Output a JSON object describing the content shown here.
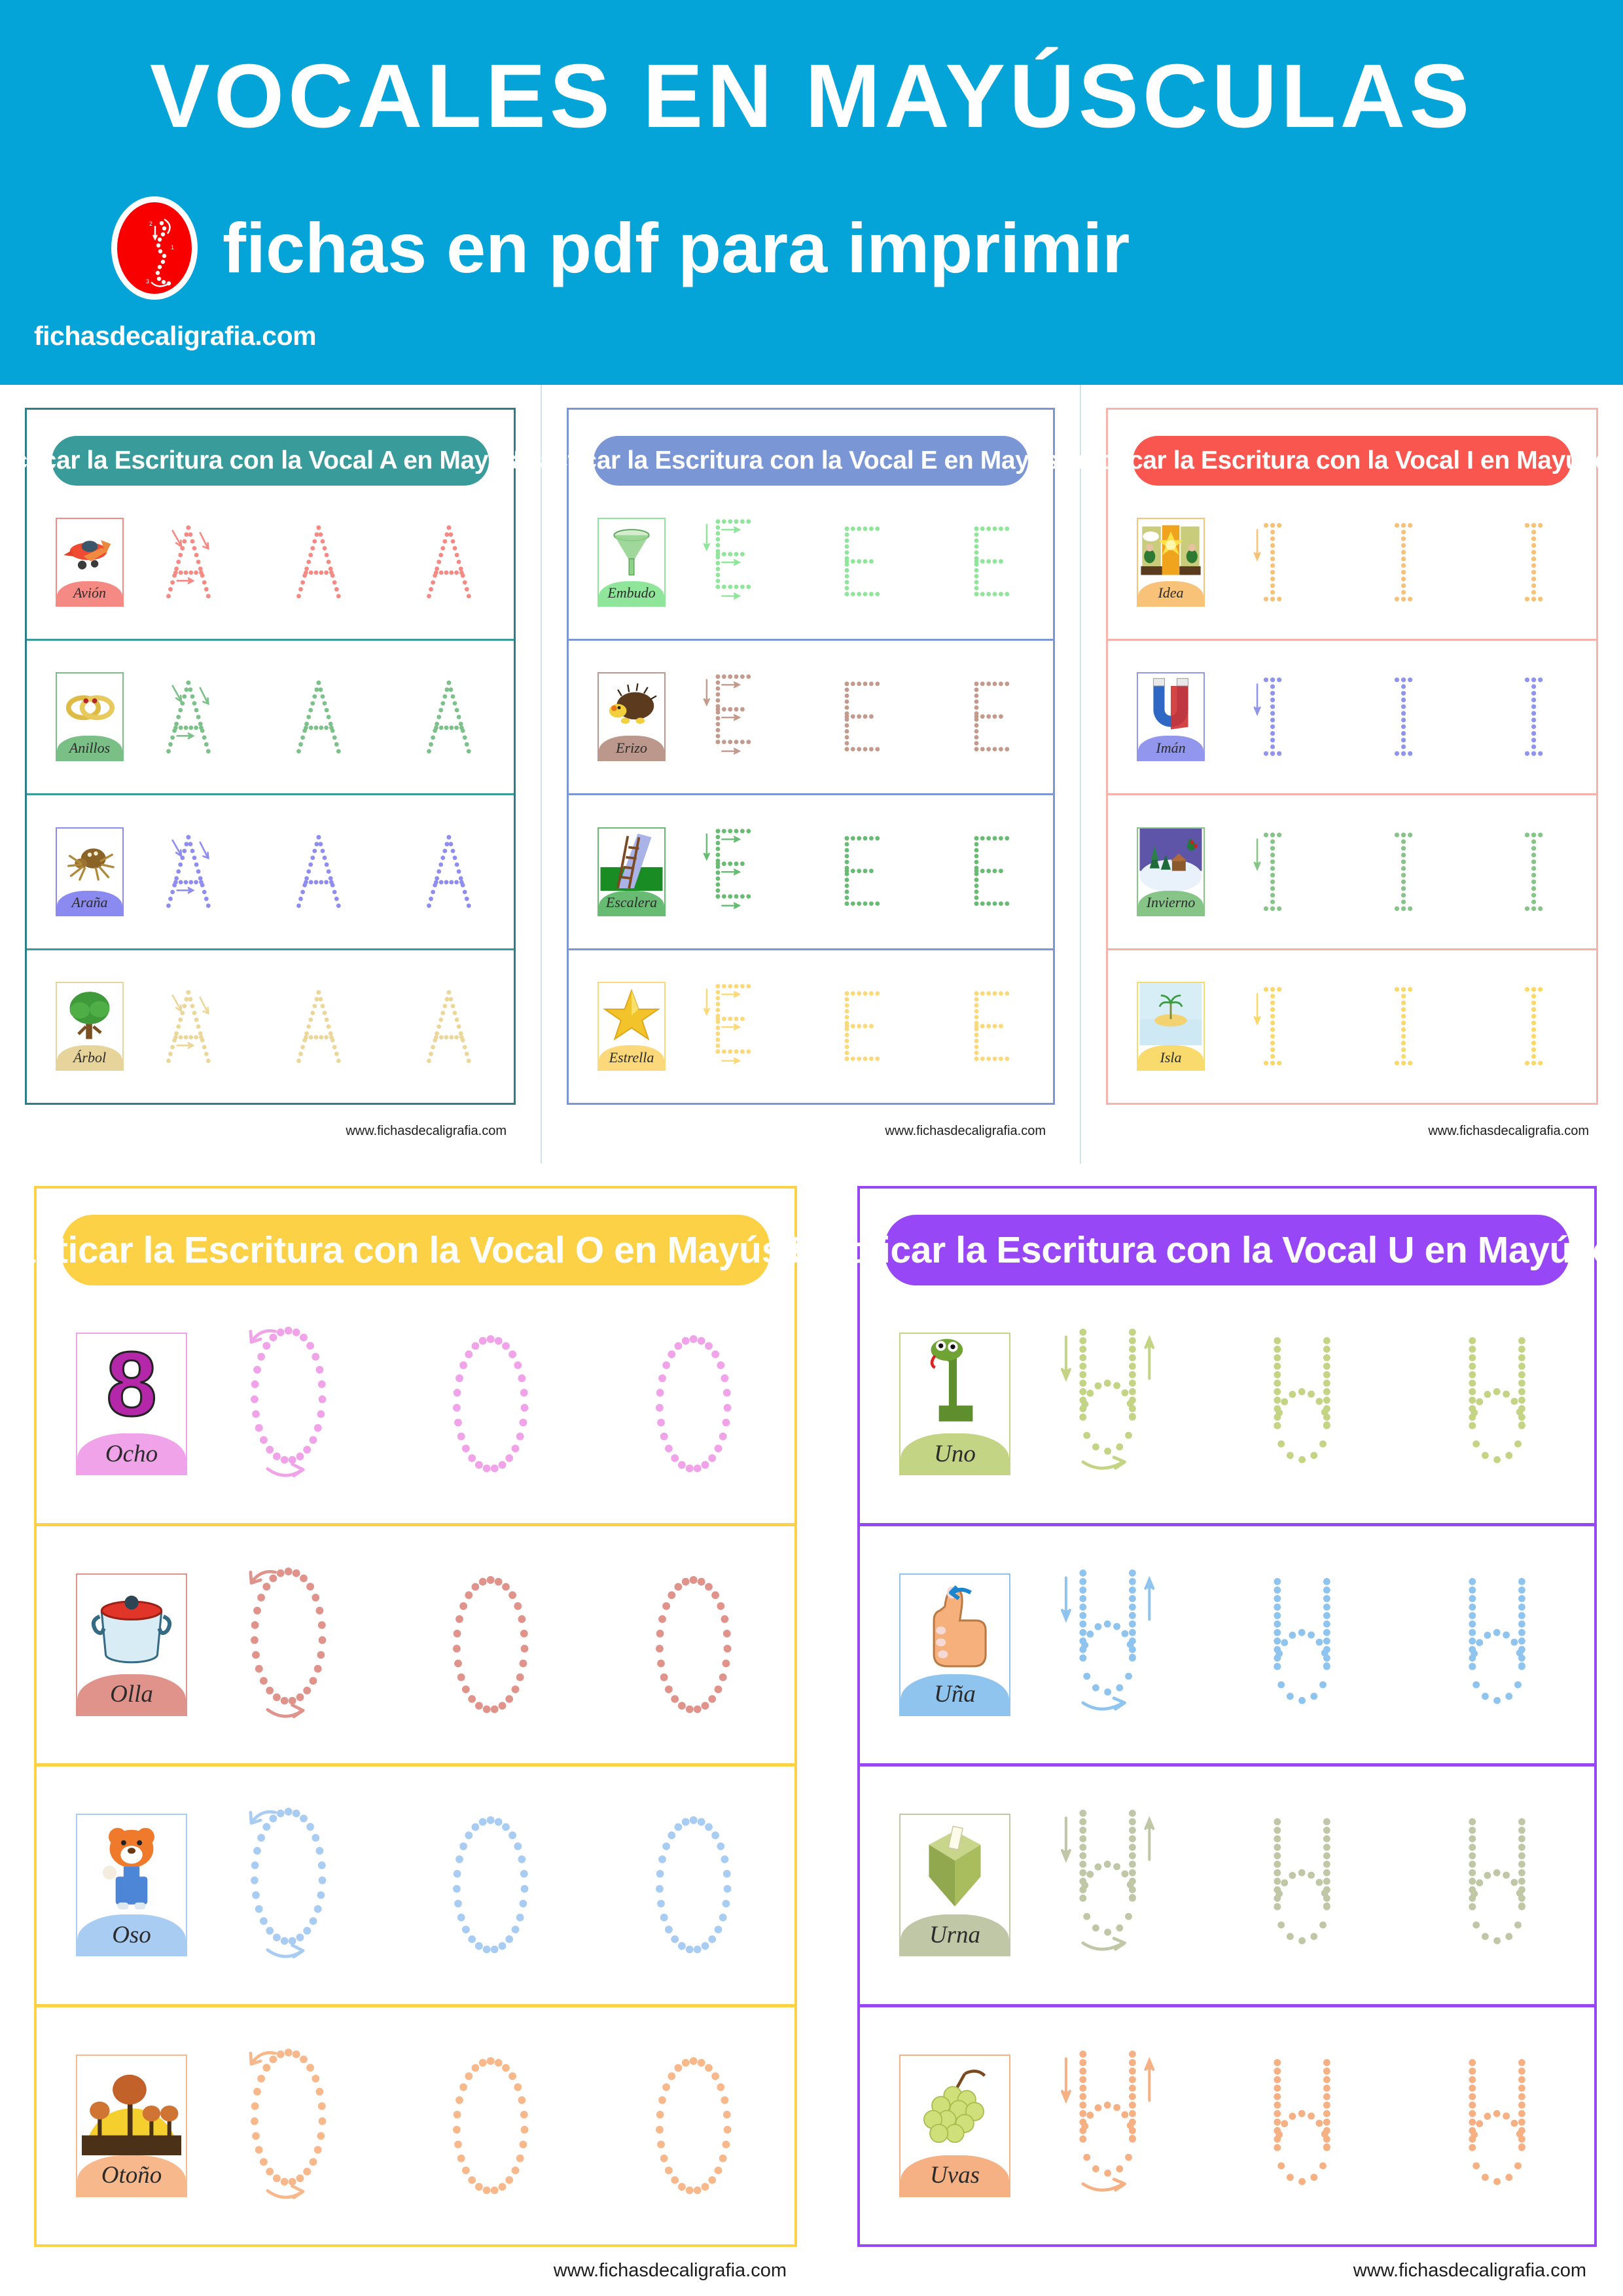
{
  "header": {
    "title": "VOCALES EN MAYÚSCULAS",
    "subtitle": "fichas en pdf para imprimir",
    "domain": "fichasdecaligrafia.com",
    "bg_color": "#05a4d8",
    "logo_color": "#f80000"
  },
  "footer_text": "www.fichasdecaligrafia.com",
  "sheets": [
    {
      "id": "A",
      "banner": "Practicar la Escritura con la Vocal A en Mayúscula",
      "accent": "#3a9b9b",
      "border": "#2d7f87",
      "divider": "#3a9b9b",
      "size": "small",
      "rows": [
        {
          "word": "Avión",
          "color": "#f58a84",
          "tint": "#f58a84",
          "art": "airplane"
        },
        {
          "word": "Anillos",
          "color": "#7cc08a",
          "tint": "#79bf86",
          "art": "rings"
        },
        {
          "word": "Araña",
          "color": "#8f8ef0",
          "tint": "#8b8af0",
          "art": "spider"
        },
        {
          "word": "Árbol",
          "color": "#ecd79a",
          "tint": "#e7d49b",
          "art": "tree"
        }
      ]
    },
    {
      "id": "E",
      "banner": "Practicar la Escritura con la Vocal E en Mayúscula",
      "accent": "#7b96d4",
      "border": "#7b96d4",
      "divider": "#7b96d4",
      "size": "small",
      "rows": [
        {
          "word": "Embudo",
          "color": "#8fe69a",
          "tint": "#8fe69a",
          "art": "funnel"
        },
        {
          "word": "Erizo",
          "color": "#c39a8c",
          "tint": "#bb988b",
          "art": "hedgehog"
        },
        {
          "word": "Escalera",
          "color": "#68bb72",
          "tint": "#68bb72",
          "art": "ladder"
        },
        {
          "word": "Estrella",
          "color": "#fbd97a",
          "tint": "#fbd97a",
          "art": "star"
        }
      ]
    },
    {
      "id": "I",
      "banner": "Practicar la Escritura con la Vocal I en Mayúscula",
      "accent": "#f9564f",
      "border": "#f8b4ac",
      "divider": "#f6b0a8",
      "size": "small",
      "rows": [
        {
          "word": "Idea",
          "color": "#f7c278",
          "tint": "#f8c379",
          "art": "idea"
        },
        {
          "word": "Imán",
          "color": "#8f94ec",
          "tint": "#9296ec",
          "art": "magnet"
        },
        {
          "word": "Invierno",
          "color": "#86c488",
          "tint": "#86c488",
          "art": "winter"
        },
        {
          "word": "Isla",
          "color": "#f8d96a",
          "tint": "#f9da6c",
          "art": "island"
        }
      ]
    },
    {
      "id": "O",
      "banner": "Practicar la Escritura con la Vocal O en Mayúscula",
      "accent": "#fcd145",
      "border": "#fcd145",
      "divider": "#fcd145",
      "size": "big",
      "rows": [
        {
          "word": "Ocho",
          "color": "#f0a3e8",
          "tint": "#f0a3e8",
          "art": "eight"
        },
        {
          "word": "Olla",
          "color": "#e0938b",
          "tint": "#e0938b",
          "art": "pot"
        },
        {
          "word": "Oso",
          "color": "#a9cdf2",
          "tint": "#a9cdf2",
          "art": "bear"
        },
        {
          "word": "Otoño",
          "color": "#f7b98c",
          "tint": "#f7b98c",
          "art": "autumn"
        }
      ]
    },
    {
      "id": "U",
      "banner": "Practicar la Escritura con la Vocal U en Mayúscula",
      "accent": "#9747f5",
      "border": "#9747f5",
      "divider": "#9747f5",
      "size": "big",
      "rows": [
        {
          "word": "Uno",
          "color": "#c4d485",
          "tint": "#c4d485",
          "art": "one"
        },
        {
          "word": "Uña",
          "color": "#8fc4ef",
          "tint": "#8fc4ef",
          "art": "thumb"
        },
        {
          "word": "Urna",
          "color": "#c0c7a6",
          "tint": "#c0c7a6",
          "art": "urn"
        },
        {
          "word": "Uvas",
          "color": "#f5b184",
          "tint": "#f5b184",
          "art": "grapes"
        }
      ]
    }
  ]
}
